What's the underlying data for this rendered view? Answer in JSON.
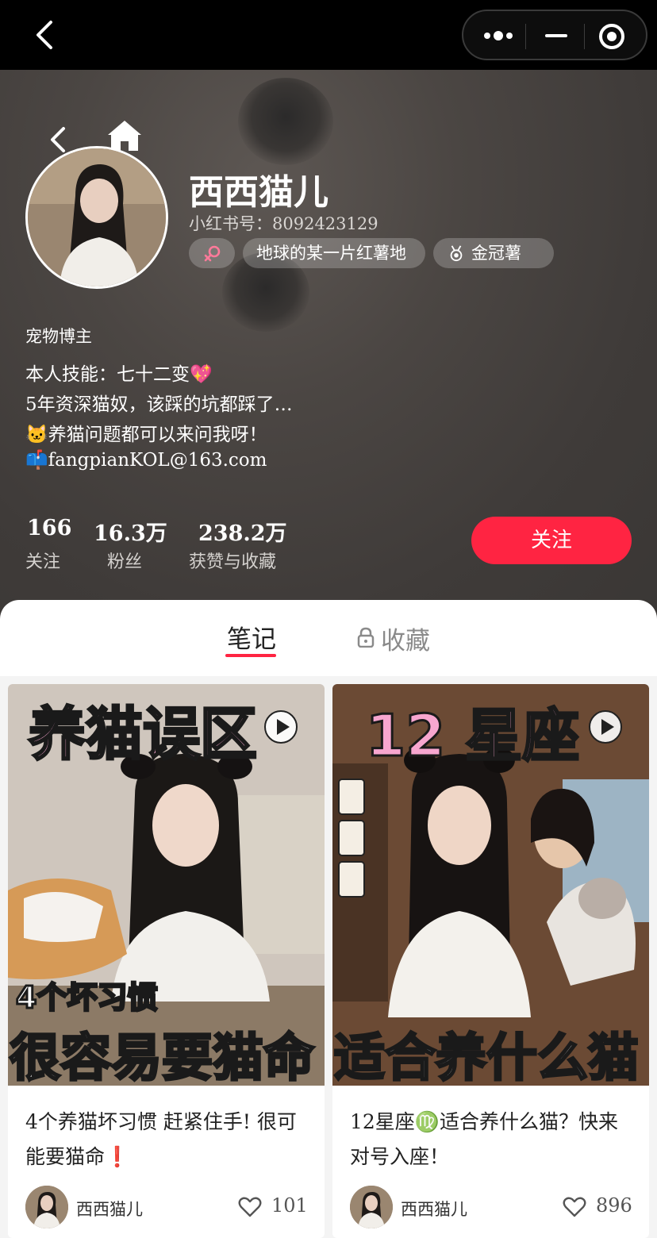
{
  "profile": {
    "nickname": "西西猫儿",
    "redbook_id": "小红书号：8092423129",
    "gender_icon": "female-icon",
    "location_tag": "地球的某一片红薯地",
    "level_tag": "金冠薯",
    "category": "宠物博主",
    "bio": [
      "本人技能：七十二变💖",
      "5年资深猫奴，该踩的坑都踩了…",
      "🐱养猫问题都可以来问我呀！",
      "📫fangpianKOL@163.com"
    ]
  },
  "stats": [
    {
      "value": "166",
      "label": "关注"
    },
    {
      "value": "16.3万",
      "label": "粉丝"
    },
    {
      "value": "238.2万",
      "label": "获赞与收藏"
    }
  ],
  "follow_button": "关注",
  "tabs": {
    "notes": "笔记",
    "favorites": "收藏"
  },
  "notes": [
    {
      "cover_top": "养猫误区",
      "cover_bottom": "很容易要猫命",
      "cover_sub": "4个坏习惯",
      "title": "4个养猫坏习惯 赶紧住手! 很可能要猫命❗",
      "author": "西西猫儿",
      "likes": "101"
    },
    {
      "cover_top": "12 星座",
      "cover_bottom": "适合养什么猫",
      "cover_sub": "",
      "title": "12星座♍适合养什么猫？快来对号入座！",
      "author": "西西猫儿",
      "likes": "896"
    }
  ],
  "colors": {
    "accent": "#ff2442",
    "header_bg": "#46413e",
    "cover_pink": "#f7a6cf"
  }
}
